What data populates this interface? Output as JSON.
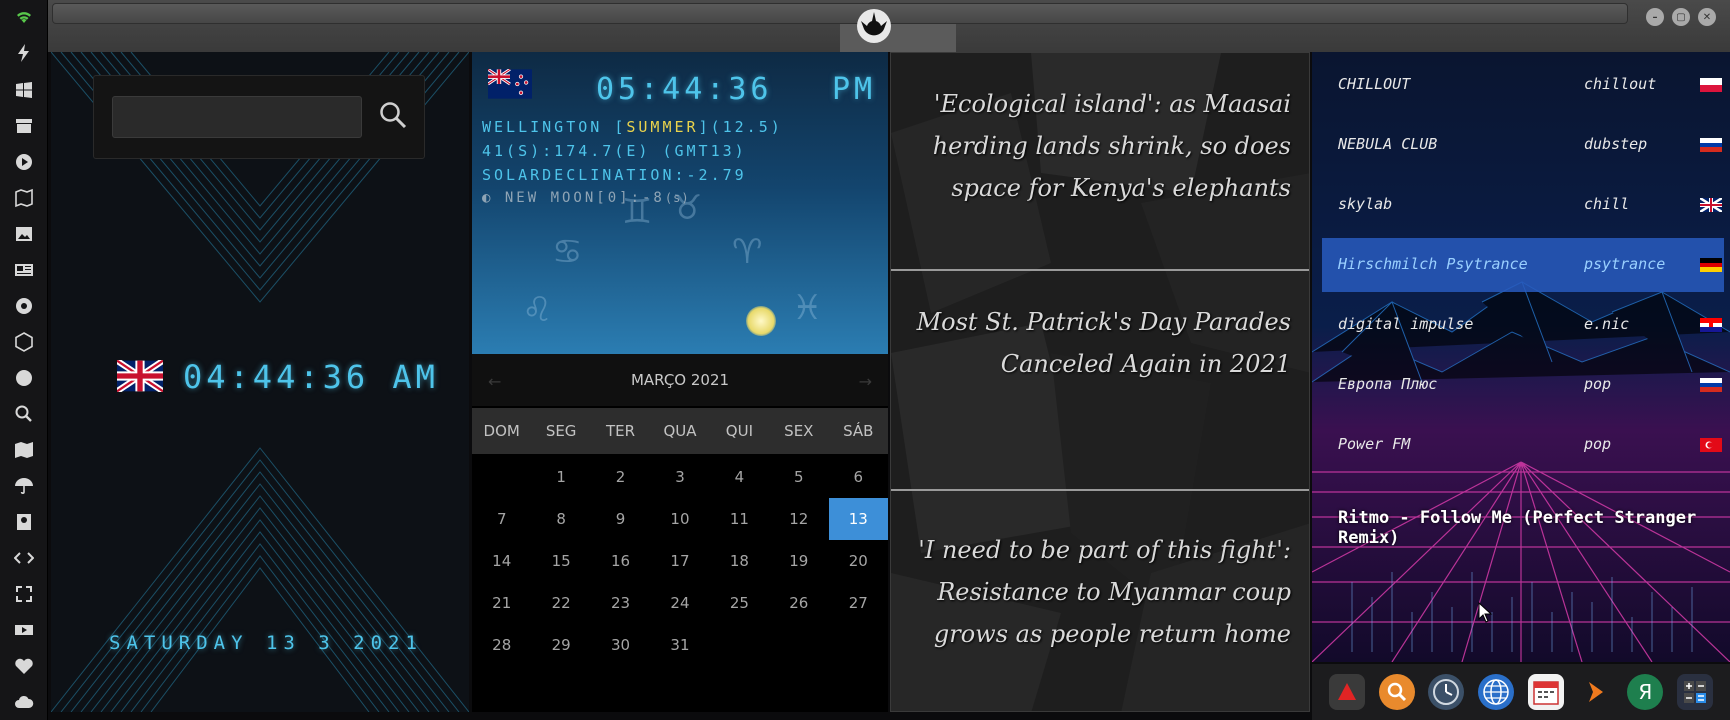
{
  "iconbar": {
    "icons": [
      "wifi-icon",
      "flash-icon",
      "windows-icon",
      "archive-icon",
      "play-icon",
      "map-book-icon",
      "image-icon",
      "newspaper-icon",
      "settings-wheel-icon",
      "hexagon-icon",
      "globe-icon",
      "search-icon",
      "map-icon",
      "umbrella-icon",
      "contacts-icon",
      "code-icon",
      "fullscreen-icon",
      "youtube-icon",
      "heart-icon",
      "cloud-icon"
    ]
  },
  "window": {
    "logo": "rebel-alliance-logo"
  },
  "clock": {
    "search_placeholder": "",
    "time": "04:44:36 AM",
    "date": "SATURDAY 13 3 2021",
    "flag": "uk-flag"
  },
  "nz": {
    "time": "05:44:36",
    "ampm": "PM",
    "city": "WELLINGTON [",
    "season": "SUMMER",
    "city_tail": "](12.5)",
    "coords": "41(S):174.7(E) (GMT13)",
    "solar": "SOLARDECLINATION:-2.79",
    "moon": "NEW MOON[0]:-8",
    "moon_suffix": "(s)"
  },
  "calendar": {
    "month": "MARÇO 2021",
    "prev": "←",
    "next": "→",
    "weekdays": [
      "DOM",
      "SEG",
      "TER",
      "QUA",
      "QUI",
      "SEX",
      "SÁB"
    ],
    "weeks": [
      [
        "",
        "1",
        "2",
        "3",
        "4",
        "5",
        "6"
      ],
      [
        "7",
        "8",
        "9",
        "10",
        "11",
        "12",
        "13"
      ],
      [
        "14",
        "15",
        "16",
        "17",
        "18",
        "19",
        "20"
      ],
      [
        "21",
        "22",
        "23",
        "24",
        "25",
        "26",
        "27"
      ],
      [
        "28",
        "29",
        "30",
        "31",
        "",
        "",
        ""
      ]
    ],
    "today": "13"
  },
  "news": {
    "items": [
      "'Ecological island': as Maasai herding lands shrink, so does space for Kenya's elephants",
      "Most St. Patrick's Day Parades Canceled Again in 2021",
      "'I need to be part of this fight': Resistance to Myanmar coup grows as people return home"
    ]
  },
  "radio": {
    "stations": [
      {
        "name": "CHILLOUT",
        "genre": "chillout",
        "flag": "poland"
      },
      {
        "name": "NEBULA CLUB",
        "genre": "dubstep",
        "flag": "russia"
      },
      {
        "name": "skylab",
        "genre": "chill",
        "flag": "uk"
      },
      {
        "name": "Hirschmilch Psytrance",
        "genre": "psytrance",
        "flag": "germany"
      },
      {
        "name": "digital impulse",
        "genre": "e.nic",
        "flag": "croatia"
      },
      {
        "name": "Европа Плюс",
        "genre": "pop",
        "flag": "russia"
      },
      {
        "name": "Power FM",
        "genre": "pop",
        "flag": "turkey"
      }
    ],
    "highlighted": "Hirschmilch Psytrance",
    "now_playing": "Ritmo - Follow Me (Perfect Stranger Remix)"
  },
  "dock": {
    "apps": [
      "arrow-app-icon",
      "search-app-icon",
      "clock-app-icon",
      "globe-app-icon",
      "calendar-app-icon",
      "arrow-right-app-icon",
      "yandex-app-icon",
      "calculator-app-icon"
    ]
  },
  "colors": {
    "accent": "#4ec4ea",
    "highlight": "#3d8fd8",
    "season": "#e9d34c"
  }
}
